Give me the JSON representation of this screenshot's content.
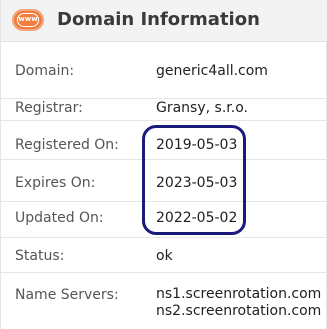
{
  "header": {
    "icon_text": "www",
    "title": "Domain Information"
  },
  "rows": [
    {
      "label": "Domain:",
      "value": "generic4all.com"
    },
    {
      "label": "Registrar:",
      "value": "Gransy, s.r.o."
    },
    {
      "label": "Registered On:",
      "value": "2019-05-03"
    },
    {
      "label": "Expires On:",
      "value": "2023-05-03"
    },
    {
      "label": "Updated On:",
      "value": "2022-05-02"
    },
    {
      "label": "Status:",
      "value": "ok"
    },
    {
      "label": "Name Servers:",
      "values": [
        "ns1.screenrotation.com",
        "ns2.screenrotation.com"
      ]
    }
  ],
  "colors": {
    "icon": "#f07e3f",
    "header_bg": "#f3f3f3",
    "highlight": "#1a1a7a"
  }
}
